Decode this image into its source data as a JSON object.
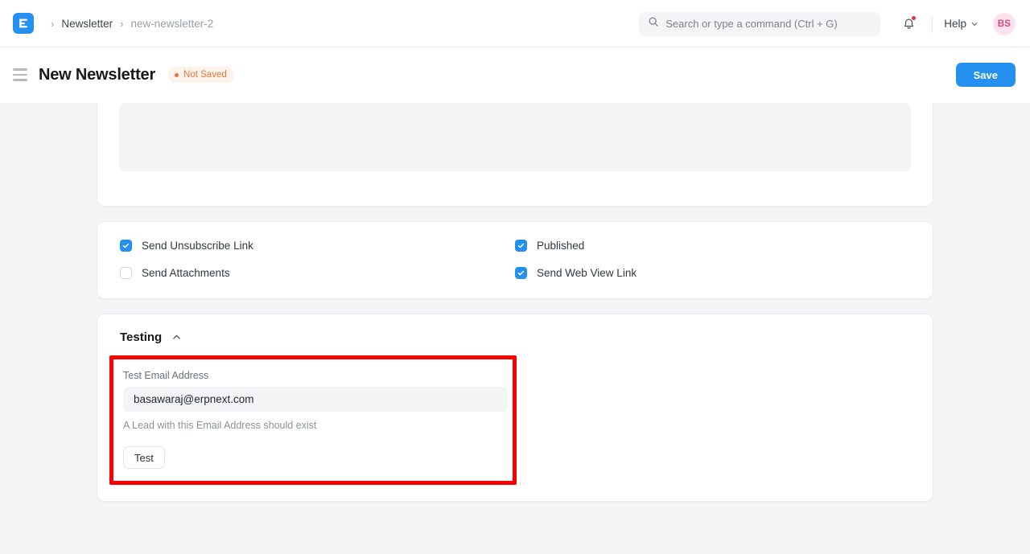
{
  "navbar": {
    "logo_icon": "erpnext-logo-icon",
    "breadcrumb": {
      "separator": "›",
      "parent": "Newsletter",
      "current": "new-newsletter-2"
    },
    "search": {
      "icon": "search-icon",
      "placeholder": "Search or type a command (Ctrl + G)"
    },
    "notifications_icon": "bell-icon",
    "help_label": "Help",
    "help_chevron_icon": "chevron-down-icon",
    "avatar_initials": "BS"
  },
  "page_header": {
    "menu_icon": "hamburger-menu-icon",
    "title": "New Newsletter",
    "status_badge": "Not Saved",
    "save_label": "Save"
  },
  "sections": {
    "checkboxes": {
      "left": [
        {
          "label": "Send Unsubscribe Link",
          "checked": true
        },
        {
          "label": "Send Attachments",
          "checked": false
        }
      ],
      "right": [
        {
          "label": "Published",
          "checked": true
        },
        {
          "label": "Send Web View Link",
          "checked": true
        }
      ]
    },
    "testing": {
      "title": "Testing",
      "collapse_icon": "chevron-up-icon",
      "field_label": "Test Email Address",
      "field_value": "basawaraj@erpnext.com",
      "field_help": "A Lead with this Email Address should exist",
      "test_button": "Test"
    }
  },
  "colors": {
    "accent": "#2490ef",
    "warning": "#e8763a",
    "highlight": "#fb0000",
    "avatar_bg": "#fbe3ee",
    "avatar_fg": "#e0457b",
    "page_bg": "#f4f5f6"
  }
}
